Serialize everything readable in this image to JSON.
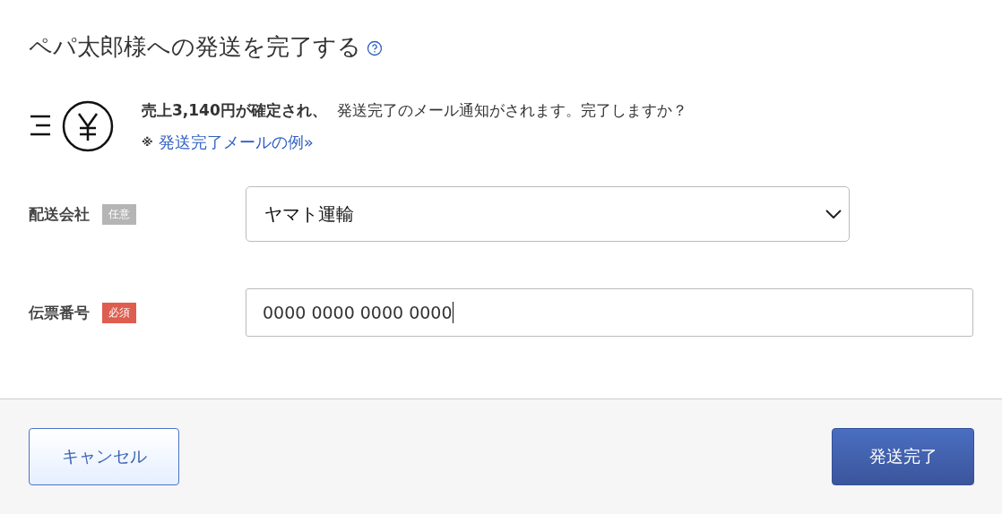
{
  "title": "ペパ太郎様への発送を完了する",
  "notice": {
    "text": "**売上3,140円が確定され、** 発送完了のメール通知がされます。完了しますか？",
    "note_mark": "※",
    "link": "発送完了メールの例»"
  },
  "fields": [
    {
      "label": "配送会社",
      "badge": "任意",
      "kind": "select",
      "value": "ヤマト運輸"
    },
    {
      "label": "伝票番号",
      "badge": "必須",
      "kind": "input",
      "value": "0000 0000 0000 0000"
    }
  ],
  "buttons": [
    {
      "label": "キャンセル",
      "kind": "secondary"
    },
    {
      "label": "発送完了",
      "kind": "primary"
    }
  ]
}
